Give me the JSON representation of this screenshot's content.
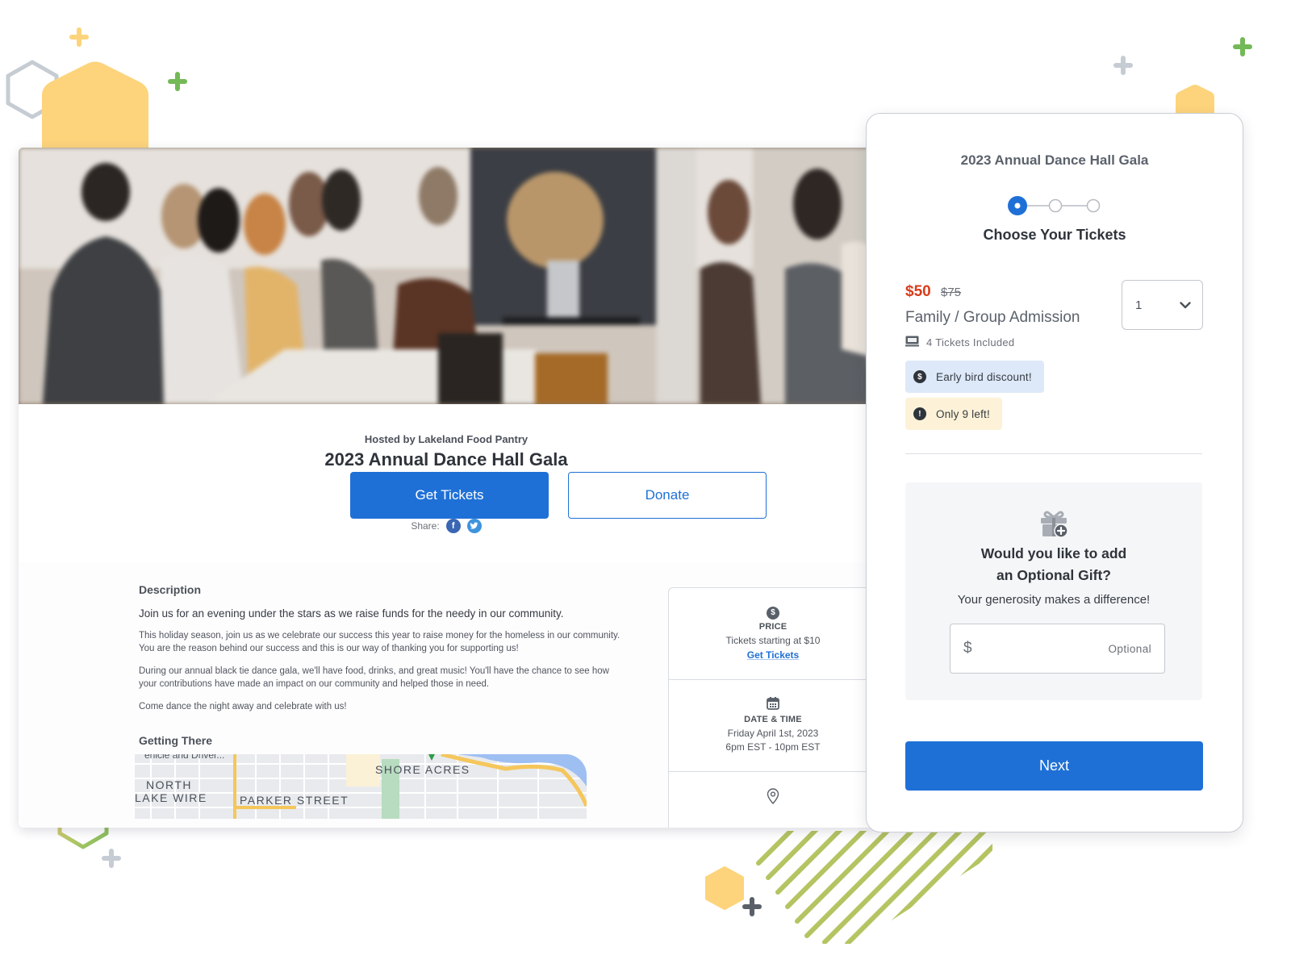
{
  "event_page": {
    "hosted_by": "Hosted by Lakeland Food Pantry",
    "title": "2023 Annual Dance Hall Gala",
    "get_tickets_label": "Get Tickets",
    "donate_label": "Donate",
    "share_label": "Share:",
    "share_icons": [
      "facebook-icon",
      "twitter-icon"
    ],
    "description": {
      "heading": "Description",
      "lead": "Join us for an evening under the stars as we raise funds for the needy in our community.",
      "paragraphs": [
        "This holiday season, join us as we celebrate our success this year to raise money for the homeless in our community. You are the reason behind our success and this is our way of thanking you for supporting us!",
        "During our annual black tie dance gala, we'll have food, drinks, and great music! You'll have the chance to see how your contributions have made an impact on our community and helped those in need.",
        "Come dance the night away and celebrate with us!"
      ]
    },
    "getting_there": {
      "heading": "Getting There",
      "map_labels": {
        "truncated": "ehicle and Driver...",
        "north": "NORTH",
        "lake_wire": "LAKE WIRE",
        "parker_street": "PARKER STREET",
        "shore_acres": "SHORE ACRES"
      }
    },
    "info": {
      "price": {
        "icon": "dollar-circle-icon",
        "label": "PRICE",
        "text": "Tickets starting at $10",
        "link": "Get Tickets"
      },
      "datetime": {
        "icon": "calendar-icon",
        "label": "DATE & TIME",
        "date": "Friday April 1st, 2023",
        "time": "6pm EST - 10pm EST"
      },
      "location": {
        "icon": "location-pin-icon"
      }
    }
  },
  "checkout": {
    "event_title": "2023 Annual Dance Hall Gala",
    "steps": {
      "total": 3,
      "current": 1
    },
    "step_title": "Choose Your Tickets",
    "ticket": {
      "price": "$50",
      "original_price": "$75",
      "name": "Family / Group Admission",
      "included": "4 Tickets Included",
      "quantity": "1"
    },
    "badges": [
      {
        "icon": "dollar-circle-icon",
        "text": "Early bird discount!",
        "color": "#dde9f8"
      },
      {
        "icon": "alert-circle-icon",
        "text": "Only 9 left!",
        "color": "#fdf2d8"
      }
    ],
    "gift": {
      "icon": "gift-add-icon",
      "question_line1": "Would you like to add",
      "question_line2": "an Optional Gift?",
      "subtitle": "Your generosity makes a difference!",
      "currency": "$",
      "placeholder": "Optional",
      "value": ""
    },
    "next_label": "Next"
  },
  "colors": {
    "primary": "#1f70d6",
    "sale_price": "#d93b1a",
    "accent_yellow": "#fdd47c",
    "accent_green": "#74b957",
    "accent_gray": "#c6ccd3"
  }
}
